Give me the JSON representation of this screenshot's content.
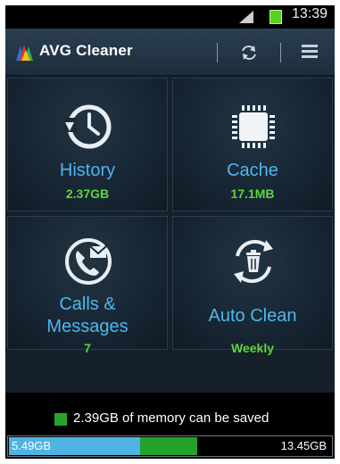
{
  "status_bar": {
    "time": "13:39"
  },
  "app_bar": {
    "title": "AVG Cleaner",
    "refresh_icon": "refresh-icon",
    "menu_icon": "menu-icon"
  },
  "tiles": [
    {
      "title": "History",
      "value": "2.37GB",
      "icon": "history-clock-icon"
    },
    {
      "title": "Cache",
      "value": "17.1MB",
      "icon": "chip-icon"
    },
    {
      "title": "Calls &",
      "title2": "Messages",
      "value": "7",
      "icon": "phone-message-icon"
    },
    {
      "title": "Auto Clean",
      "value": "Weekly",
      "icon": "auto-clean-trash-icon"
    }
  ],
  "memory": {
    "saved_text": "2.39GB of memory can be saved",
    "used_label": "5.49GB",
    "total_label": "13.45GB",
    "used_fraction": 0.408,
    "saveable_fraction": 0.178
  },
  "colors": {
    "accent_blue": "#4fb6ec",
    "accent_green": "#5fd43a",
    "bar_used": "#4fb3e4",
    "bar_save": "#23a12b"
  }
}
